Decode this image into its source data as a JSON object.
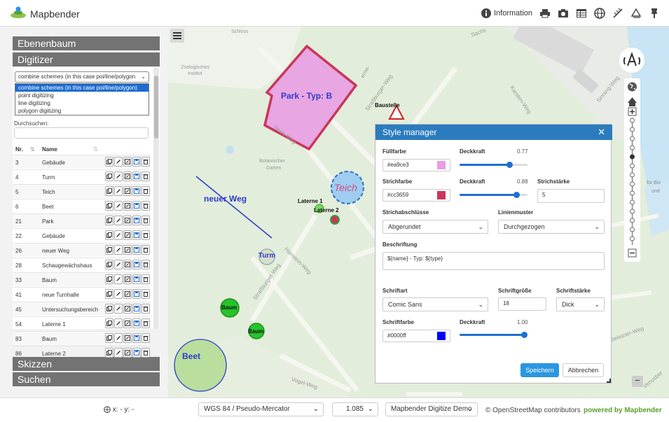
{
  "app": {
    "title": "Mapbender"
  },
  "toolbar": {
    "information_label": "Information",
    "icons": [
      "info-icon",
      "print-icon",
      "camera-icon",
      "table-icon",
      "globe-icon",
      "measure-line-icon",
      "measure-area-icon",
      "pin-icon"
    ]
  },
  "sidebar": {
    "accordion": {
      "layertree": "Ebenenbaum",
      "digitizer": "Digitizer",
      "sketches": "Skizzen",
      "search": "Suchen"
    },
    "schema_select": {
      "value": "combine schemes (in this case poi/line/polygon",
      "options": [
        "combine schemes (in this case poi/line/polygon)",
        "point digitizing",
        "line digitizing",
        "polygon digitizing"
      ]
    },
    "search_label": "Durchsuchen:",
    "table": {
      "col_nr": "Nr.",
      "col_name": "Name",
      "rows": [
        {
          "nr": "3",
          "name": "Gebäude"
        },
        {
          "nr": "4",
          "name": "Turm"
        },
        {
          "nr": "5",
          "name": "Teich"
        },
        {
          "nr": "6",
          "name": "Beet"
        },
        {
          "nr": "21",
          "name": "Park"
        },
        {
          "nr": "22",
          "name": "Gebäude"
        },
        {
          "nr": "26",
          "name": "neuer Weg"
        },
        {
          "nr": "28",
          "name": "Schaugewächshaus"
        },
        {
          "nr": "33",
          "name": "Baum"
        },
        {
          "nr": "41",
          "name": "neue Turnhalle"
        },
        {
          "nr": "45",
          "name": "Untersuchungsbereich"
        },
        {
          "nr": "54",
          "name": "Laterne 1"
        },
        {
          "nr": "83",
          "name": "Baum"
        },
        {
          "nr": "86",
          "name": "Laterne 2"
        }
      ]
    }
  },
  "map": {
    "labels": {
      "park": "Park - Typ: B",
      "teich": "Teich",
      "neuer_weg": "neuer Weg",
      "turm": "Turm",
      "baum1": "Baum",
      "baum2": "Baum",
      "beet": "Beet",
      "laterne1": "Laterne 1",
      "laterne2": "Laterne 2",
      "baustelle": "Baustelle"
    },
    "streets": {
      "schloss": "Schloss",
      "zoo": "Zoologisches",
      "institut": "Institut",
      "botan": "Botanischer",
      "garten": "Garten",
      "nees": "Nees-Weg",
      "strasb": "Straßburger-Weg",
      "hanstein": "Hanstein-Weg",
      "vogel": "Vogel-Weg",
      "karsten": "Karsten-Weg",
      "sinning": "Sinning-Weg",
      "fur": "für Bio",
      "und": "und",
      "beissner": "Beissner-Weg",
      "sachs": "Sachs",
      "erne": "erne-",
      "venus": "Venusber"
    }
  },
  "style_manager": {
    "title": "Style manager",
    "fill_color_label": "Füllfarbe",
    "fill_color": "#ea9ce3",
    "fill_opacity_label": "Deckkraft",
    "fill_opacity": "0.77",
    "stroke_color_label": "Strichfarbe",
    "stroke_color": "#cc3659",
    "stroke_opacity_label": "Deckkraft",
    "stroke_opacity": "0.88",
    "stroke_width_label": "Strichstärke",
    "stroke_width": "5",
    "linecap_label": "Strichabschlüsse",
    "linecap": "Abgerundet",
    "dash_label": "Linienmuster",
    "dash": "Durchgezogen",
    "label_label": "Beschriftung",
    "label": "${name} - Typ: ${type}",
    "font_label": "Schriftart",
    "font": "Comic Sans",
    "font_size_label": "Schriftgröße",
    "font_size": "18",
    "font_weight_label": "Schriftstärke",
    "font_weight": "Dick",
    "font_color_label": "Schriftfarbe",
    "font_color": "#0000ff",
    "font_opacity_label": "Deckkraft",
    "font_opacity": "1.00",
    "save": "Speichern",
    "cancel": "Abbrechen"
  },
  "footer": {
    "coords": "x: - y: -",
    "srs": "WGS 84 / Pseudo-Mercator",
    "scale": "1.085",
    "app": "Mapbender Digitize Demo",
    "attribution": "© OpenStreetMap contributors",
    "powered": "powered by Mapbender"
  }
}
